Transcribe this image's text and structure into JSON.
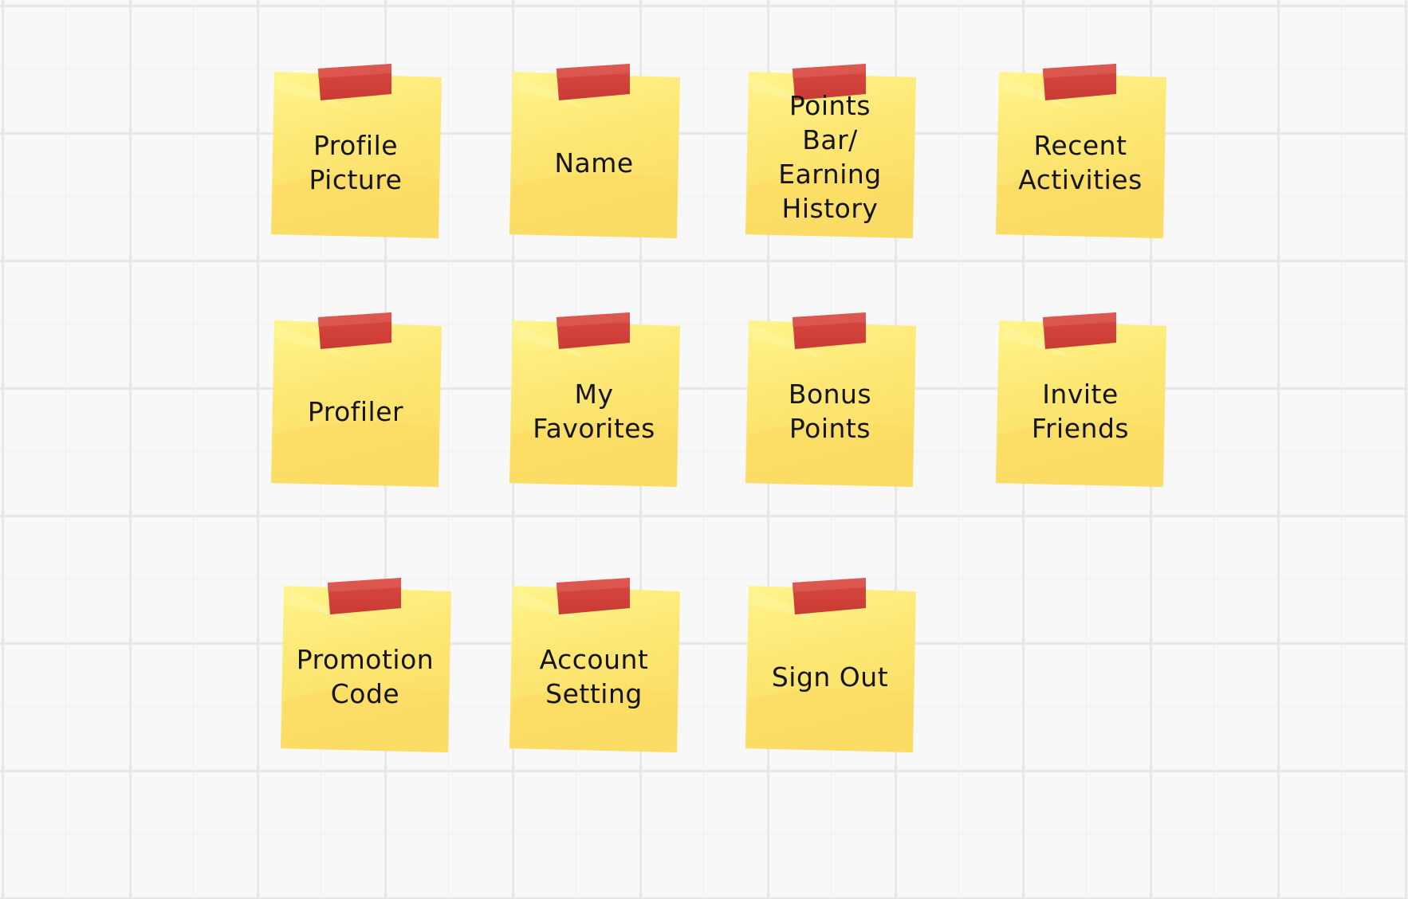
{
  "notes": [
    {
      "id": "profile-picture",
      "label": "Profile\nPicture"
    },
    {
      "id": "name",
      "label": "Name"
    },
    {
      "id": "points-bar-earning-history",
      "label": "Points\nBar/\nEarning\nHistory"
    },
    {
      "id": "recent-activities",
      "label": "Recent\nActivities"
    },
    {
      "id": "profiler",
      "label": "Profiler"
    },
    {
      "id": "my-favorites",
      "label": "My\nFavorites"
    },
    {
      "id": "bonus-points",
      "label": "Bonus\nPoints"
    },
    {
      "id": "invite-friends",
      "label": "Invite\nFriends"
    },
    {
      "id": "promotion-code",
      "label": "Promotion\nCode"
    },
    {
      "id": "account-setting",
      "label": "Account\nSetting"
    },
    {
      "id": "sign-out",
      "label": "Sign Out"
    }
  ],
  "colors": {
    "note": "#fde36e",
    "note_highlight": "#fff38e",
    "note_shadow": "#f4d155",
    "tape": "#d13f36",
    "tape_highlight": "#e0645c",
    "grid": "#e7e7e7",
    "background": "#f8f8f8",
    "text": "#141414"
  }
}
